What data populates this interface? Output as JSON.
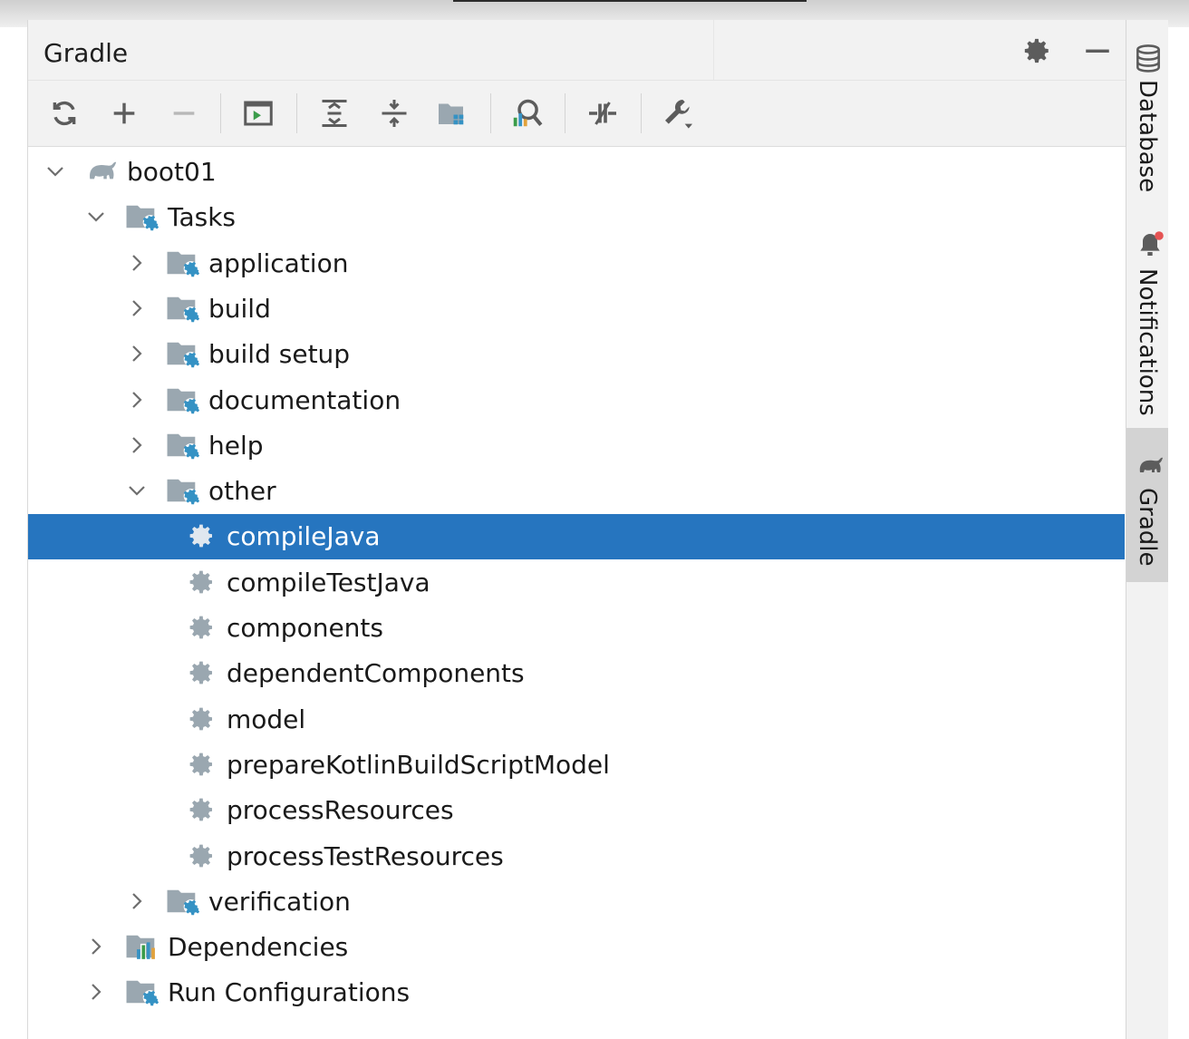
{
  "panel": {
    "title": "Gradle",
    "header_icons": [
      "gear-icon",
      "minimize-icon"
    ]
  },
  "toolbar": {
    "buttons": [
      {
        "icon": "reload-icon",
        "name": "reload"
      },
      {
        "icon": "plus-icon",
        "name": "link-project"
      },
      {
        "icon": "minus-icon",
        "name": "unlink-project"
      },
      {
        "icon": "execute-task-icon",
        "name": "execute-task"
      },
      {
        "icon": "expand-all-icon",
        "name": "expand-all"
      },
      {
        "icon": "collapse-all-icon",
        "name": "collapse-all"
      },
      {
        "icon": "group-modules-icon",
        "name": "group-modules"
      },
      {
        "icon": "analyze-dependencies-icon",
        "name": "analyze-dependencies"
      },
      {
        "icon": "toggle-offline-icon",
        "name": "toggle-offline"
      },
      {
        "icon": "build-tool-settings-icon",
        "name": "build-tool-settings"
      }
    ]
  },
  "tree": [
    {
      "label": "boot01",
      "level": 0,
      "expanded": true,
      "icon": "elephant-icon"
    },
    {
      "label": "Tasks",
      "level": 1,
      "expanded": true,
      "icon": "task-folder-icon"
    },
    {
      "label": "application",
      "level": 2,
      "expanded": false,
      "icon": "task-folder-icon"
    },
    {
      "label": "build",
      "level": 2,
      "expanded": false,
      "icon": "task-folder-icon"
    },
    {
      "label": "build setup",
      "level": 2,
      "expanded": false,
      "icon": "task-folder-icon"
    },
    {
      "label": "documentation",
      "level": 2,
      "expanded": false,
      "icon": "task-folder-icon"
    },
    {
      "label": "help",
      "level": 2,
      "expanded": false,
      "icon": "task-folder-icon"
    },
    {
      "label": "other",
      "level": 2,
      "expanded": true,
      "icon": "task-folder-icon"
    },
    {
      "label": "compileJava",
      "level": 3,
      "icon": "gear-icon",
      "selected": true
    },
    {
      "label": "compileTestJava",
      "level": 3,
      "icon": "gear-icon"
    },
    {
      "label": "components",
      "level": 3,
      "icon": "gear-icon"
    },
    {
      "label": "dependentComponents",
      "level": 3,
      "icon": "gear-icon"
    },
    {
      "label": "model",
      "level": 3,
      "icon": "gear-icon"
    },
    {
      "label": "prepareKotlinBuildScriptModel",
      "level": 3,
      "icon": "gear-icon"
    },
    {
      "label": "processResources",
      "level": 3,
      "icon": "gear-icon"
    },
    {
      "label": "processTestResources",
      "level": 3,
      "icon": "gear-icon"
    },
    {
      "label": "verification",
      "level": 2,
      "expanded": false,
      "icon": "task-folder-icon"
    },
    {
      "label": "Dependencies",
      "level": 1,
      "expanded": false,
      "icon": "dependencies-icon"
    },
    {
      "label": "Run Configurations",
      "level": 1,
      "expanded": false,
      "icon": "task-folder-icon"
    }
  ],
  "right_sidebar": [
    {
      "label": "Database",
      "icon": "database-icon",
      "active": false
    },
    {
      "label": "Notifications",
      "icon": "bell-icon",
      "active": false
    },
    {
      "label": "Gradle",
      "icon": "elephant-icon",
      "active": true
    }
  ],
  "colors": {
    "selection": "#2675bf",
    "panel_bg": "#ffffff",
    "header_bg": "#f2f2f2",
    "icon_blue": "#3592c4",
    "icon_grey": "#9aa7b0",
    "notification_dot": "#e55353"
  }
}
